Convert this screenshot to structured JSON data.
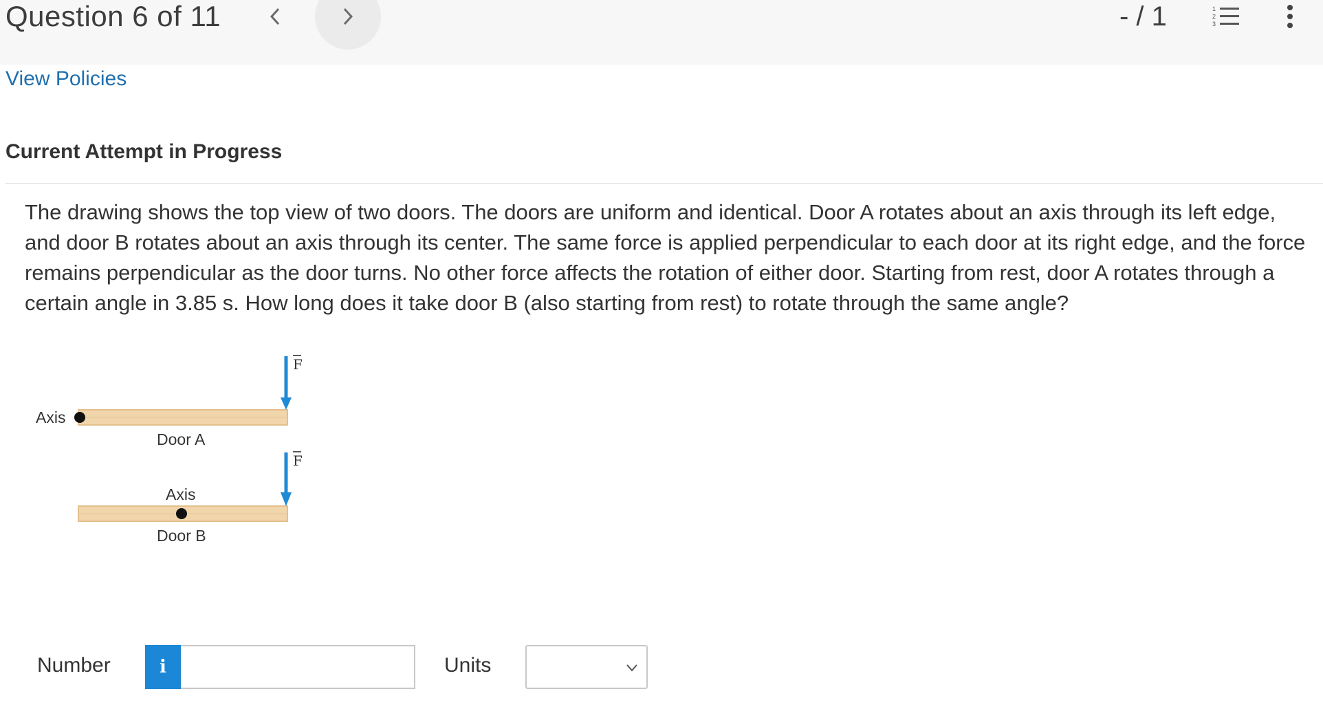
{
  "header": {
    "question_counter": "Question 6 of 11",
    "prev_icon": "chevron-left-icon",
    "next_icon": "chevron-right-icon",
    "score": "- / 1",
    "list_icon": "numbered-list-icon",
    "more_icon": "vertical-ellipsis-icon"
  },
  "policies_link": "View Policies",
  "attempt_heading": "Current Attempt in Progress",
  "question": {
    "text": "The drawing shows the top view of two doors. The doors are uniform and identical. Door A rotates about an axis through its left edge, and door B rotates about an axis through its center. The same force is applied perpendicular to each door at its right edge, and the force remains perpendicular as the door turns. No other force affects the rotation of either door. Starting from rest, door A rotates through a certain angle in 3.85 s. How long does it take door B (also starting from rest) to rotate through the same angle?"
  },
  "figure": {
    "door_a_axis_label": "Axis",
    "door_a_label": "Door A",
    "door_b_axis_label": "Axis",
    "door_b_label": "Door B",
    "force_label": "F",
    "colors": {
      "door": "#f1d5ab",
      "door_stripe": "#e3bf8c",
      "arrow": "#1f8ad6",
      "axis_dot": "#111111"
    }
  },
  "answer": {
    "number_label": "Number",
    "info_icon": "info-icon",
    "info_text": "i",
    "number_value": "",
    "units_label": "Units",
    "units_selected": ""
  }
}
